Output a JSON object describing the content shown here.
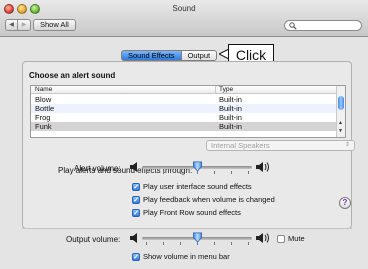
{
  "window": {
    "title": "Sound"
  },
  "toolbar": {
    "back_icon": "triangle-left",
    "forward_icon": "triangle-right",
    "show_all_label": "Show All",
    "search_placeholder": ""
  },
  "tabs": [
    {
      "label": "Sound Effects",
      "active": true
    },
    {
      "label": "Output",
      "active": false
    }
  ],
  "callout": {
    "text": "Click"
  },
  "sound_effects": {
    "section_title": "Choose an alert sound",
    "columns": [
      "Name",
      "Type"
    ],
    "rows": [
      {
        "name": "Blow",
        "type": "Built-in",
        "selected": false
      },
      {
        "name": "Bottle",
        "type": "Built-in",
        "selected": false
      },
      {
        "name": "Frog",
        "type": "Built-in",
        "selected": false
      },
      {
        "name": "Funk",
        "type": "Built-in",
        "selected": true
      }
    ],
    "play_through_label": "Play alerts and sound effects through:",
    "play_through_value": "Internal Speakers",
    "alert_volume_label": "Alert volume:",
    "alert_volume_level": 0.5,
    "checkboxes": [
      {
        "label": "Play user interface sound effects",
        "checked": true
      },
      {
        "label": "Play feedback when volume is changed",
        "checked": true
      },
      {
        "label": "Play Front Row sound effects",
        "checked": true
      }
    ],
    "help_label": "?"
  },
  "footer": {
    "output_volume_label": "Output volume:",
    "output_volume_level": 0.5,
    "mute_label": "Mute",
    "mute_checked": false,
    "show_volume_label": "Show volume in menu bar",
    "show_volume_checked": true
  },
  "colors": {
    "accent": "#2f7fe0",
    "help_glyph": "#6a2bb0"
  }
}
